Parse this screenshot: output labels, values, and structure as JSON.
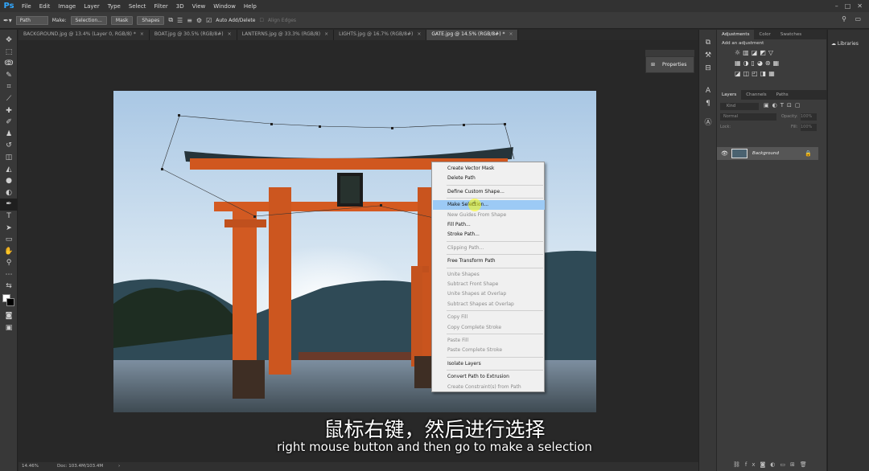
{
  "app": {
    "logo": "Ps"
  },
  "menu": [
    "File",
    "Edit",
    "Image",
    "Layer",
    "Type",
    "Select",
    "Filter",
    "3D",
    "View",
    "Window",
    "Help"
  ],
  "options": {
    "mode": "Path",
    "make_label": "Make:",
    "selection_btn": "Selection...",
    "mask_btn": "Mask",
    "shapes_btn": "Shapes",
    "auto_add": "Auto Add/Delete",
    "align_edges": "Align Edges"
  },
  "tabs": [
    {
      "label": "BACKGROUND.jpg @ 13.4% (Layer 0, RGB/8) *",
      "active": false
    },
    {
      "label": "BOAT.jpg @ 30.5% (RGB/8#)",
      "active": false
    },
    {
      "label": "LANTERNS.jpg @ 33.3% (RGB/8)",
      "active": false
    },
    {
      "label": "LIGHTS.jpg @ 16.7% (RGB/8#)",
      "active": false
    },
    {
      "label": "GATE.jpg @ 14.5% (RGB/8#) *",
      "active": true
    }
  ],
  "properties_label": "Properties",
  "context_menu": [
    {
      "label": "Create Vector Mask",
      "enabled": true
    },
    {
      "label": "Delete Path",
      "enabled": true
    },
    {
      "sep": true
    },
    {
      "label": "Define Custom Shape...",
      "enabled": true
    },
    {
      "sep": true
    },
    {
      "label": "Make Selection...",
      "enabled": true,
      "highlight": true
    },
    {
      "label": "New Guides From Shape",
      "enabled": false
    },
    {
      "label": "Fill Path...",
      "enabled": true
    },
    {
      "label": "Stroke Path...",
      "enabled": true
    },
    {
      "sep": true
    },
    {
      "label": "Clipping Path...",
      "enabled": false
    },
    {
      "sep": true
    },
    {
      "label": "Free Transform Path",
      "enabled": true
    },
    {
      "sep": true
    },
    {
      "label": "Unite Shapes",
      "enabled": false
    },
    {
      "label": "Subtract Front Shape",
      "enabled": false
    },
    {
      "label": "Unite Shapes at Overlap",
      "enabled": false
    },
    {
      "label": "Subtract Shapes at Overlap",
      "enabled": false
    },
    {
      "sep": true
    },
    {
      "label": "Copy Fill",
      "enabled": false
    },
    {
      "label": "Copy Complete Stroke",
      "enabled": false
    },
    {
      "sep": true
    },
    {
      "label": "Paste Fill",
      "enabled": false
    },
    {
      "label": "Paste Complete Stroke",
      "enabled": false
    },
    {
      "sep": true
    },
    {
      "label": "Isolate Layers",
      "enabled": true
    },
    {
      "sep": true
    },
    {
      "label": "Convert Path to Extrusion",
      "enabled": true
    },
    {
      "label": "Create Constraint(s) from Path",
      "enabled": false
    }
  ],
  "adjustments": {
    "tabs": [
      "Adjustments",
      "Color",
      "Swatches"
    ],
    "title": "Add an adjustment"
  },
  "layers": {
    "tabs": [
      "Layers",
      "Channels",
      "Paths"
    ],
    "kind": "Kind",
    "blend": "Normal",
    "opacity_label": "Opacity:",
    "opacity": "100%",
    "lock_label": "Lock:",
    "fill_label": "Fill:",
    "fill": "100%",
    "layer_name": "Background"
  },
  "libraries_label": "Libraries",
  "status": {
    "zoom": "14.46%",
    "doc": "Doc: 103.4M/103.4M"
  },
  "subtitle": {
    "zh": "鼠标右键，然后进行选择",
    "en": "right mouse button and then go to make a selection"
  }
}
